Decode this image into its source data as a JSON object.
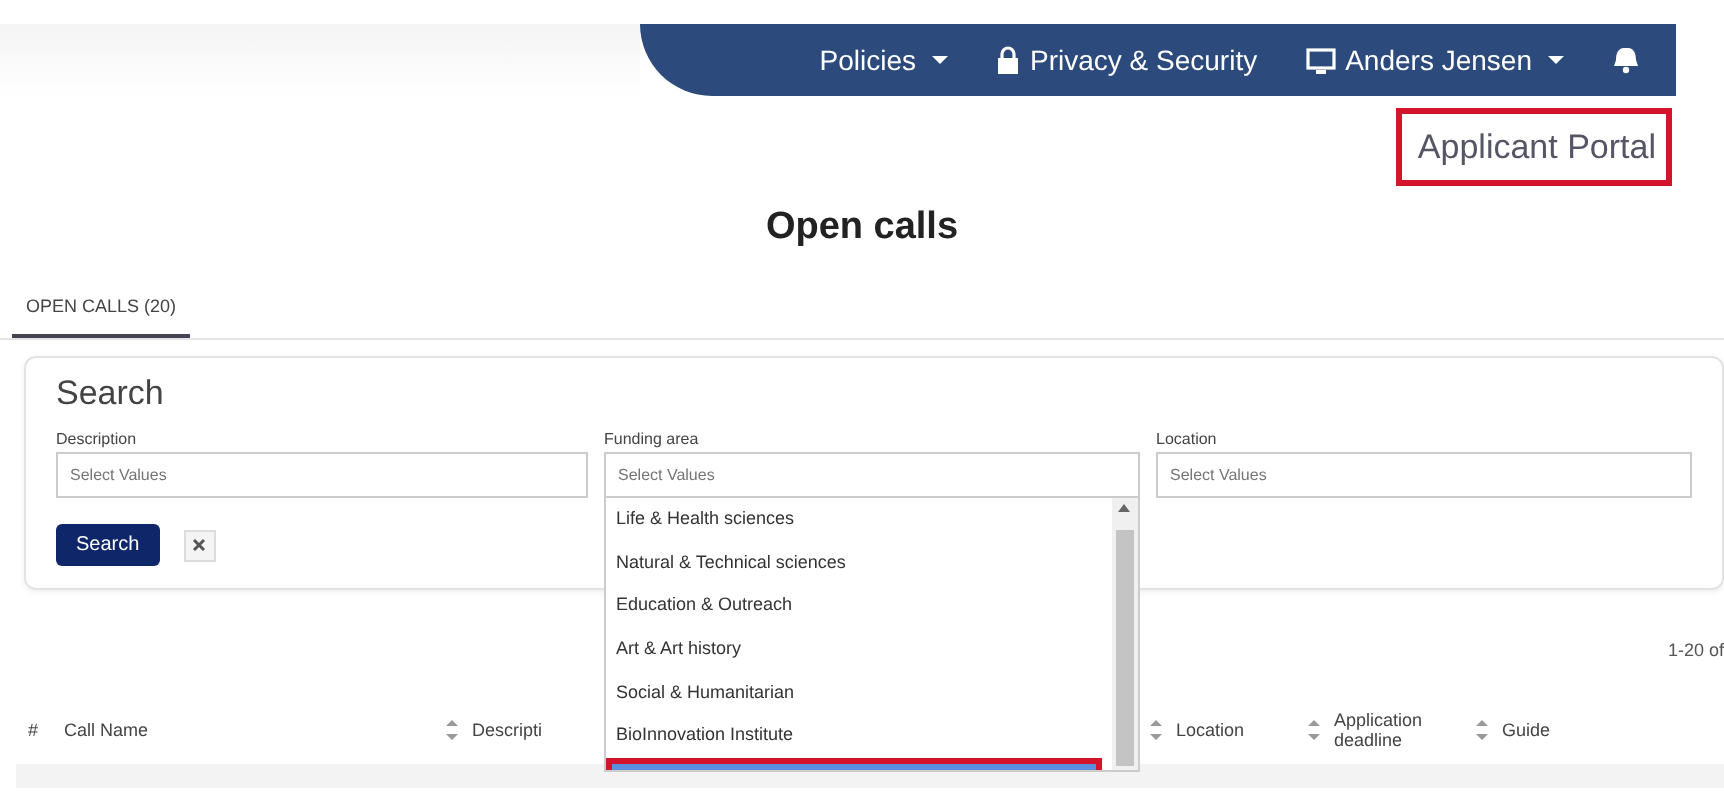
{
  "nav": {
    "items": [
      {
        "label": "Policies",
        "caret": true
      },
      {
        "label": "Privacy & Security",
        "caret": false
      },
      {
        "label": "Anders Jensen",
        "caret": true
      }
    ]
  },
  "portal_link": "Applicant Portal",
  "heading": "Open calls",
  "tabs": [
    {
      "label": "OPEN CALLS (20)",
      "selected": true
    }
  ],
  "search": {
    "title": "Search",
    "fields": [
      {
        "label": "Description",
        "placeholder": "Select Values",
        "open": false
      },
      {
        "label": "Funding area",
        "placeholder": "Select Values",
        "open": true
      },
      {
        "label": "Location",
        "placeholder": "Select Values",
        "open": false
      }
    ],
    "search_button": "Search"
  },
  "dropdown": {
    "options": [
      {
        "label": "Life & Health sciences",
        "selected": false
      },
      {
        "label": "Natural & Technical sciences",
        "selected": false
      },
      {
        "label": "Education & Outreach",
        "selected": false
      },
      {
        "label": "Art & Art history",
        "selected": false
      },
      {
        "label": "Social & Humanitarian",
        "selected": false
      },
      {
        "label": "BioInnovation Institute",
        "selected": false
      },
      {
        "selected": true
      }
    ]
  },
  "pager": "1-20 of",
  "table": {
    "columns": [
      {
        "label": "#",
        "sortable": false
      },
      {
        "label": "Call Name",
        "sortable": false
      },
      {
        "label": "Descripti",
        "sortable": true
      },
      {
        "label": "Location",
        "sortable": true
      },
      {
        "label": "Application deadline",
        "sortable": true
      },
      {
        "label": "Guide",
        "sortable": true
      }
    ]
  }
}
